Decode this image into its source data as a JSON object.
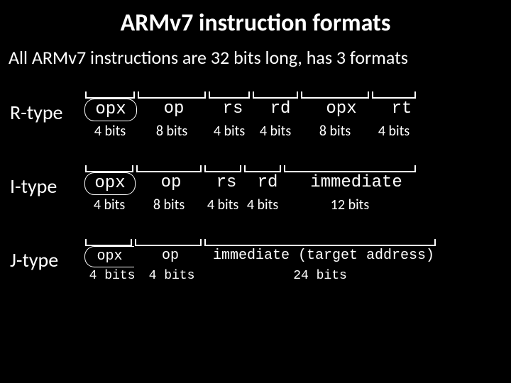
{
  "title": "ARMv7 instruction formats",
  "subtitle": "All ARMv7 instructions are 32 bits long, has 3 formats",
  "r": {
    "label": "R-type",
    "fields": [
      "opx",
      "op",
      "rs",
      "rd",
      "opx",
      "rt"
    ],
    "bits": [
      "4 bits",
      "8 bits",
      "4 bits",
      "4 bits",
      "8 bits",
      "4 bits"
    ]
  },
  "i": {
    "label": "I-type",
    "fields": [
      "opx",
      "op",
      "rs",
      "rd",
      "immediate"
    ],
    "bits": [
      "4 bits",
      "8 bits",
      "4 bits",
      "4 bits",
      "12 bits"
    ]
  },
  "j": {
    "label": "J-type",
    "fields": [
      "opx",
      "op",
      "immediate (target address)"
    ],
    "bits": [
      "4 bits",
      "4 bits",
      "24 bits"
    ]
  }
}
